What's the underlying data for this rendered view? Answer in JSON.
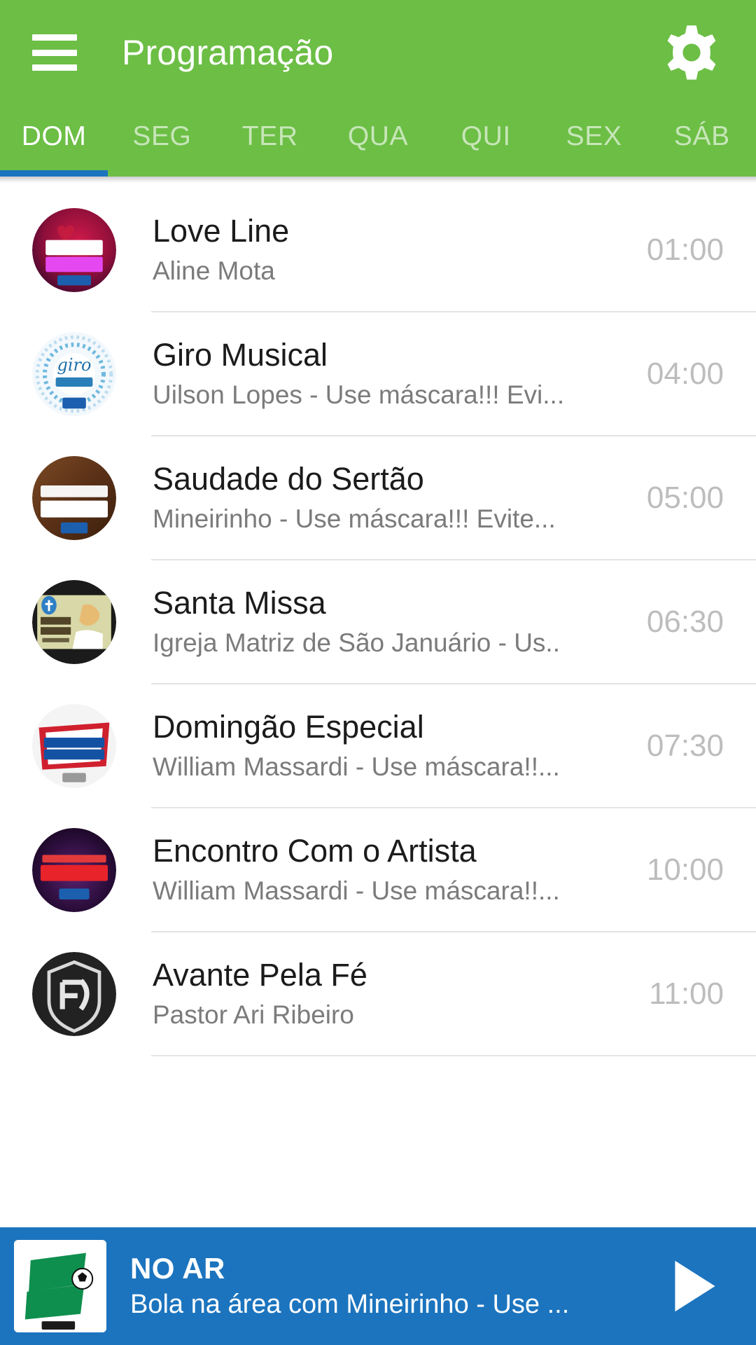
{
  "header": {
    "title": "Programação",
    "menu_icon": "hamburger-menu-icon",
    "settings_icon": "gear-icon"
  },
  "tabs": {
    "active_index": 0,
    "items": [
      {
        "label": "DOM"
      },
      {
        "label": "SEG"
      },
      {
        "label": "TER"
      },
      {
        "label": "QUA"
      },
      {
        "label": "QUI"
      },
      {
        "label": "SEX"
      },
      {
        "label": "SÁB"
      }
    ]
  },
  "schedule": [
    {
      "title": "Love Line",
      "subtitle": "Aline Mota",
      "time": "01:00",
      "art": "love-line-logo"
    },
    {
      "title": "Giro Musical",
      "subtitle": "Uilson Lopes - Use máscara!!! Evi...",
      "time": "04:00",
      "art": "giro-musical-logo"
    },
    {
      "title": "Saudade do Sertão",
      "subtitle": "Mineirinho - Use máscara!!! Evite...",
      "time": "05:00",
      "art": "saudade-do-sertao-logo"
    },
    {
      "title": "Santa Missa",
      "subtitle": "Igreja Matriz de São Januário - Us..",
      "time": "06:30",
      "art": "santa-missa-logo"
    },
    {
      "title": "Domingão Especial",
      "subtitle": "William Massardi - Use máscara!!...",
      "time": "07:30",
      "art": "domingao-especial-logo"
    },
    {
      "title": "Encontro Com o Artista",
      "subtitle": "William Massardi - Use máscara!!...",
      "time": "10:00",
      "art": "encontro-com-o-artista-logo"
    },
    {
      "title": "Avante Pela Fé",
      "subtitle": "Pastor Ari Ribeiro",
      "time": "11:00",
      "art": "avante-pela-fe-logo"
    }
  ],
  "player": {
    "status_label": "NO AR",
    "now_playing": "Bola na área com Mineirinho - Use ...",
    "art": "bola-na-area-logo",
    "play_icon": "play-triangle-icon"
  },
  "colors": {
    "brand_green": "#6cbe45",
    "accent_blue": "#1c74be",
    "title_text": "#1b1b1b",
    "subtitle_text": "#7b7b7b",
    "time_text": "#bdbdbd",
    "divider": "#e3e3e3"
  }
}
